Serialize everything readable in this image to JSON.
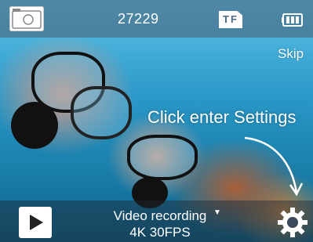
{
  "status_bar": {
    "shot_count": "27229",
    "storage_label": "TF"
  },
  "overlay": {
    "skip_label": "Skip",
    "hint_text": "Click enter Settings"
  },
  "bottom_bar": {
    "mode_label": "Video recording",
    "mode_detail": "4K 30FPS"
  },
  "icons": {
    "mode": "camera-mode-icon",
    "storage": "tf-card-icon",
    "battery": "battery-icon",
    "playback": "play-icon",
    "settings": "gear-icon"
  }
}
